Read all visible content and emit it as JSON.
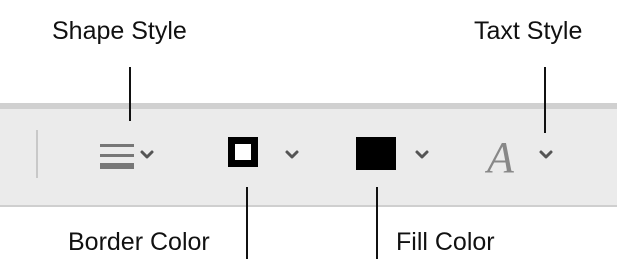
{
  "callouts": {
    "shape_style": "Shape Style",
    "text_style": "Taxt Style",
    "border_color": "Border Color",
    "fill_color": "Fill Color"
  },
  "toolbar": {
    "tools": [
      {
        "id": "shape-style",
        "icon": "line-style-icon"
      },
      {
        "id": "border-color",
        "icon": "border-color-swatch-icon",
        "color": "#000000"
      },
      {
        "id": "fill-color",
        "icon": "fill-color-swatch-icon",
        "color": "#000000"
      },
      {
        "id": "text-style",
        "icon": "italic-a-icon"
      }
    ]
  },
  "colors": {
    "toolbar_bg": "#ebebeb",
    "toolbar_border": "#d0d0d0",
    "icon_gray": "#777777",
    "swatch": "#000000"
  }
}
